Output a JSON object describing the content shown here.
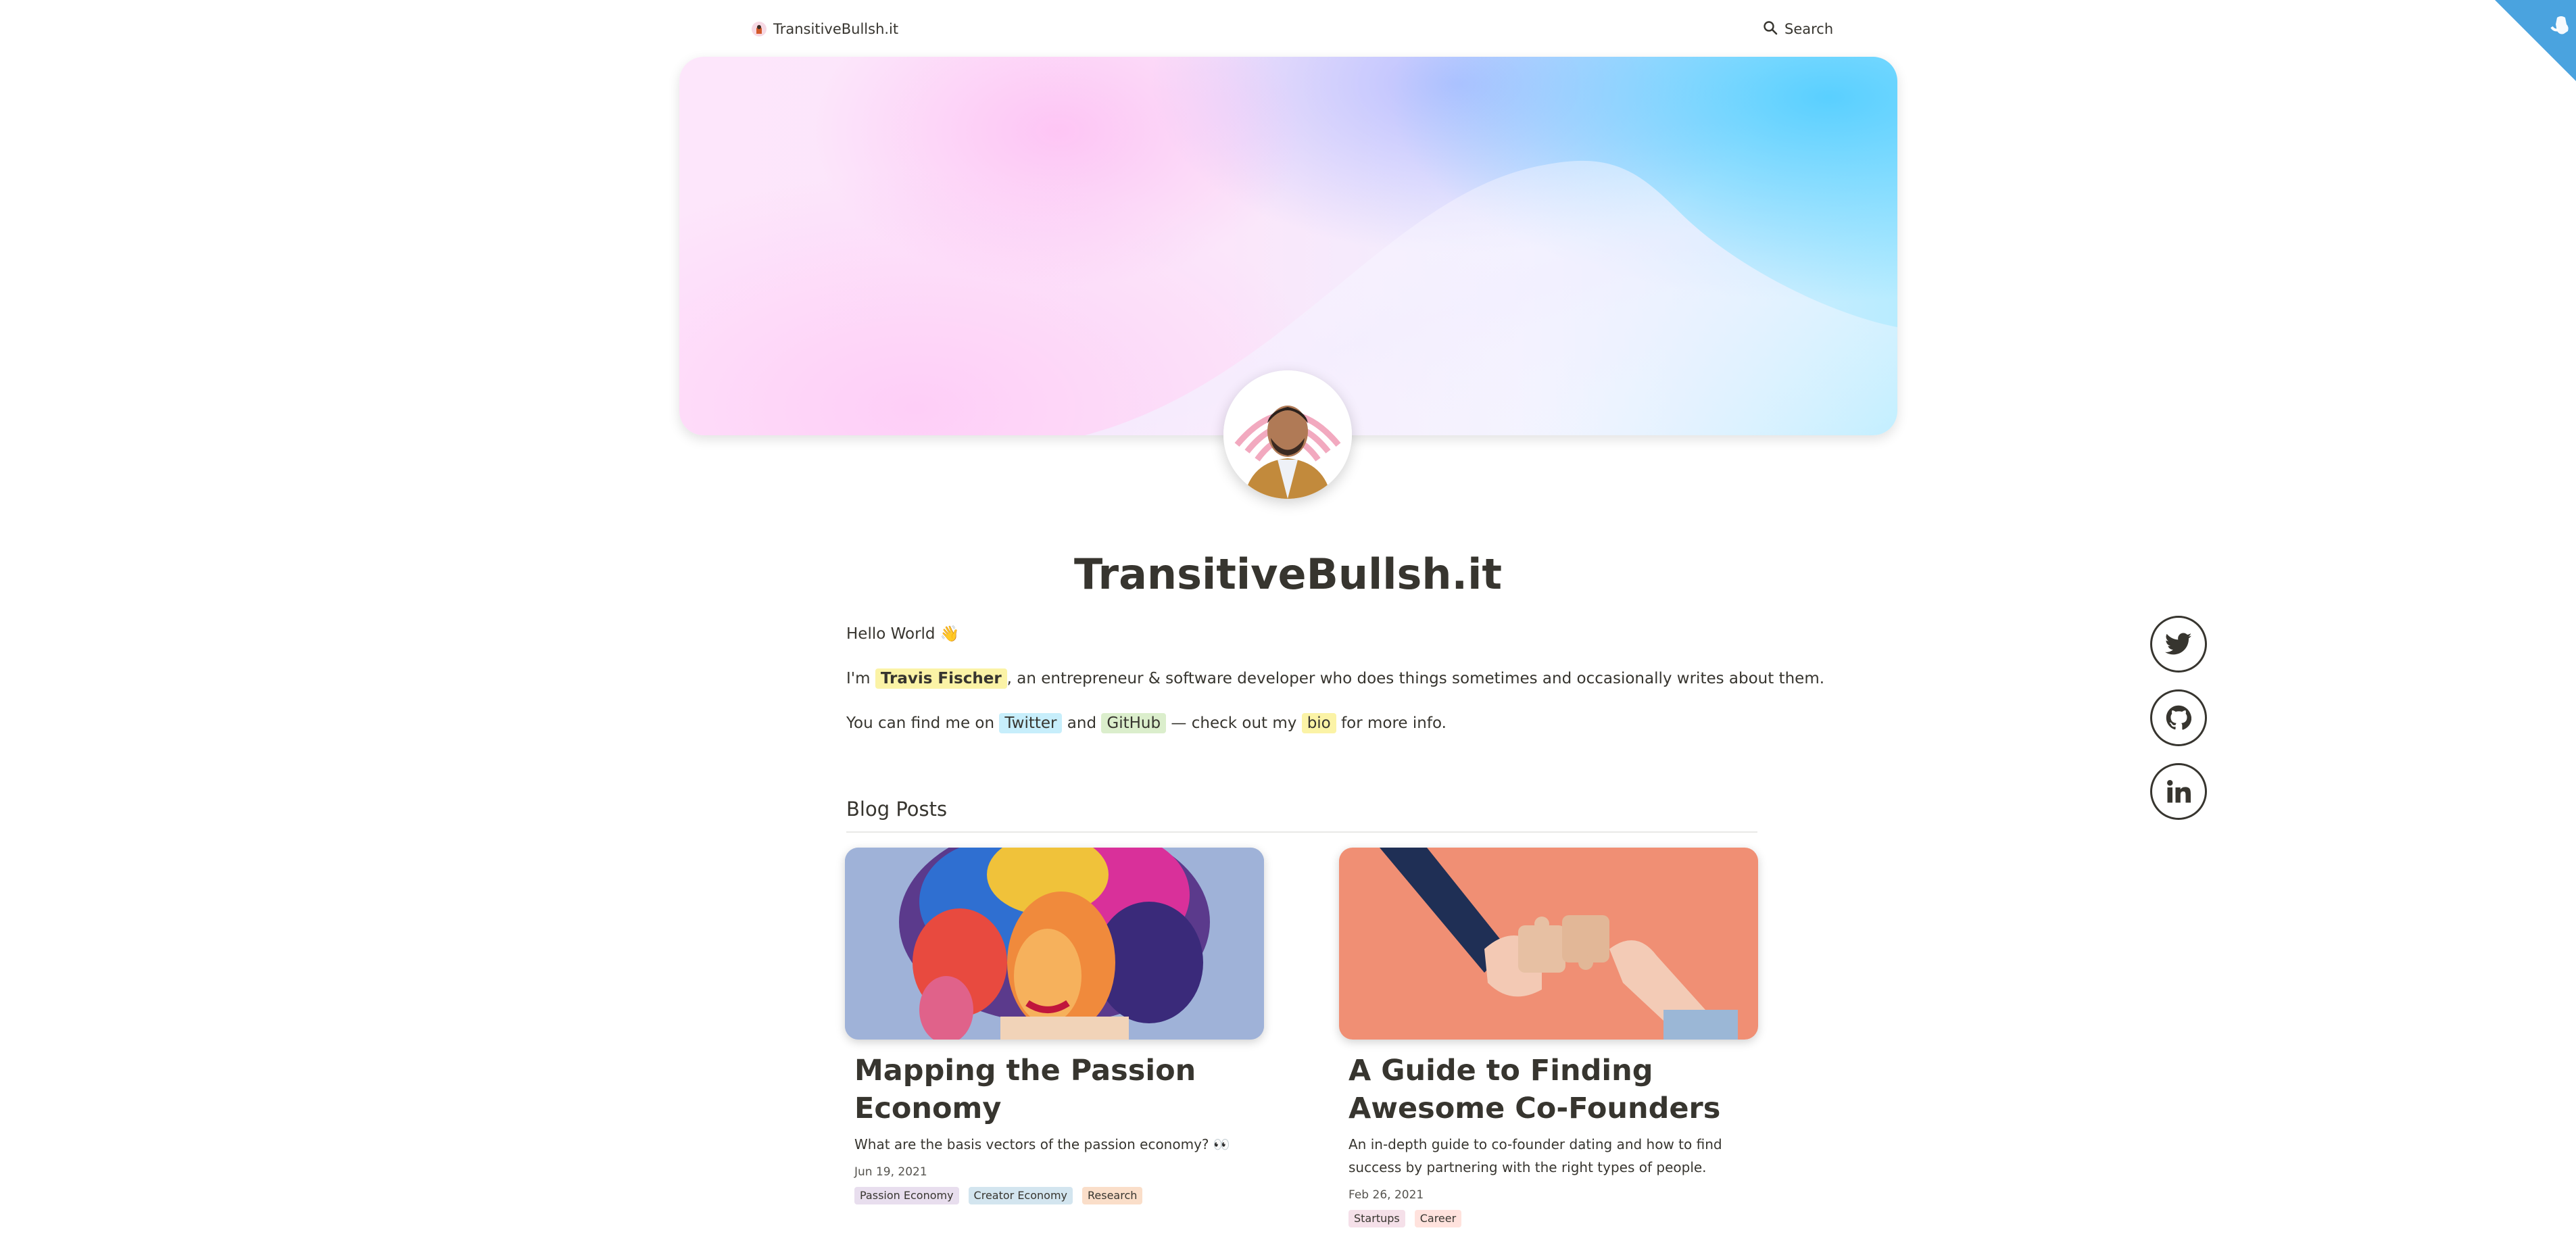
{
  "nav": {
    "brand_label": "TransitiveBullsh.it",
    "search_label": "Search"
  },
  "site_title": "TransitiveBullsh.it",
  "intro": {
    "greeting": "Hello World 👋",
    "line2_prefix": "I'm",
    "line2_name": "Travis Fischer",
    "line2_suffix": ", an entrepreneur & software developer who does things sometimes and occasionally writes about them.",
    "line3_prefix": "You can find me on",
    "line3_twitter": "Twitter",
    "line3_and": "and",
    "line3_github": "GitHub",
    "line3_mid": "— check out my",
    "line3_bio": "bio",
    "line3_suffix": "for more info."
  },
  "blog_section_title": "Blog Posts",
  "posts": [
    {
      "title": "Mapping the Passion Economy",
      "description": "What are the basis vectors of the passion economy? 👀",
      "date": "Jun 19, 2021",
      "tags": [
        "Passion Economy",
        "Creator Economy",
        "Research"
      ]
    },
    {
      "title": "A Guide to Finding Awesome Co-Founders",
      "description": "An in-depth guide to co-founder dating and how to find success by partnering with the right types of people.",
      "date": "Feb 26, 2021",
      "tags": [
        "Startups",
        "Career"
      ]
    }
  ],
  "social": [
    "twitter-icon",
    "github-icon",
    "linkedin-icon"
  ],
  "colors": {
    "text": "#37352f",
    "highlight_yellow": "#fbf3a6",
    "highlight_blue": "#c7eefb",
    "highlight_green": "#dbeecc",
    "tag_purple": "#e8deee",
    "tag_blue": "#d3e5ef",
    "tag_orange": "#fadec9",
    "tag_pink": "#f5e0e9",
    "tag_red": "#ffe2dd",
    "ribbon": "#4aa3df"
  }
}
